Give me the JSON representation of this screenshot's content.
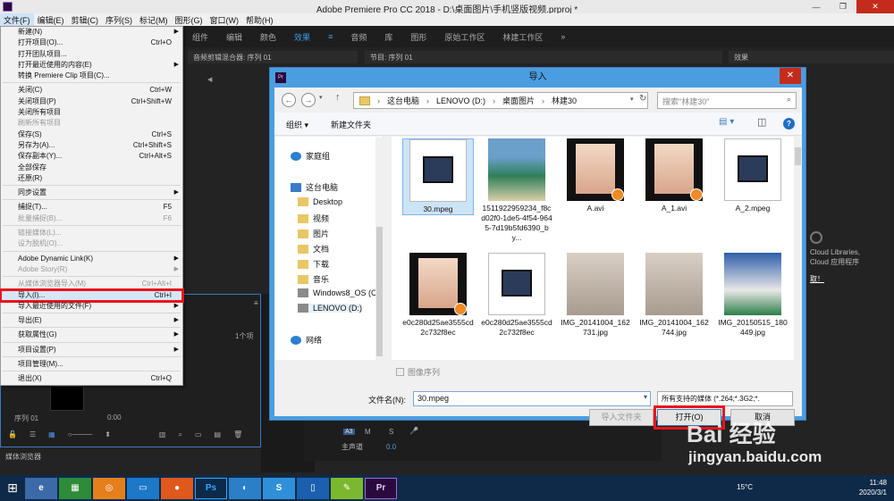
{
  "window": {
    "title": "Adobe Premiere Pro CC 2018 - D:\\桌面图片\\手机竖版视频.prproj *"
  },
  "menubar": [
    "文件(F)",
    "编辑(E)",
    "剪辑(C)",
    "序列(S)",
    "标记(M)",
    "图形(G)",
    "窗口(W)",
    "帮助(H)"
  ],
  "workspaces": [
    "组件",
    "编辑",
    "颜色",
    "效果",
    "≡",
    "音频",
    "库",
    "图形",
    "原始工作区",
    "林建工作区",
    "»"
  ],
  "panels": {
    "audio_mixer": "音频剪辑混合器: 序列 01",
    "program": "节目: 序列 01",
    "effects": "效果",
    "items_count": "1个项",
    "seq": "序列 01",
    "timecode": "0:00",
    "media_browser": "媒体浏览器",
    "track_a3": "A3",
    "master": "主声道",
    "master_val": "0.0",
    "cloud_text1": "Cloud Libraries,",
    "cloud_text2": "Cloud 应用程序",
    "cloud_text3": "取！"
  },
  "file_menu": [
    {
      "label": "新建(N)",
      "arrow": true
    },
    {
      "label": "打开项目(O)...",
      "shortcut": "Ctrl+O"
    },
    {
      "label": "打开团队项目..."
    },
    {
      "label": "打开最近使用的内容(E)",
      "arrow": true
    },
    {
      "label": "转换 Premiere Clip 项目(C)..."
    },
    {
      "sep": true
    },
    {
      "label": "关闭(C)",
      "shortcut": "Ctrl+W"
    },
    {
      "label": "关闭项目(P)",
      "shortcut": "Ctrl+Shift+W"
    },
    {
      "label": "关闭所有项目"
    },
    {
      "label": "刷新所有项目",
      "disabled": true
    },
    {
      "label": "保存(S)",
      "shortcut": "Ctrl+S"
    },
    {
      "label": "另存为(A)...",
      "shortcut": "Ctrl+Shift+S"
    },
    {
      "label": "保存副本(Y)...",
      "shortcut": "Ctrl+Alt+S"
    },
    {
      "label": "全部保存"
    },
    {
      "label": "还原(R)"
    },
    {
      "sep": true
    },
    {
      "label": "同步设置",
      "arrow": true
    },
    {
      "sep": true
    },
    {
      "label": "捕捉(T)...",
      "shortcut": "F5"
    },
    {
      "label": "批量捕捉(B)...",
      "shortcut": "F6",
      "disabled": true
    },
    {
      "sep": true
    },
    {
      "label": "链接媒体(L)...",
      "disabled": true
    },
    {
      "label": "设为脱机(O)...",
      "disabled": true
    },
    {
      "sep": true
    },
    {
      "label": "Adobe Dynamic Link(K)",
      "arrow": true
    },
    {
      "label": "Adobe Story(R)",
      "arrow": true,
      "disabled": true
    },
    {
      "sep": true
    },
    {
      "label": "从媒体浏览器导入(M)",
      "shortcut": "Ctrl+Alt+I",
      "disabled": true
    },
    {
      "label": "导入(I)...",
      "shortcut": "Ctrl+I",
      "highlight": true
    },
    {
      "label": "导入最近使用的文件(F)",
      "arrow": true
    },
    {
      "sep": true
    },
    {
      "label": "导出(E)",
      "arrow": true
    },
    {
      "sep": true
    },
    {
      "label": "获取属性(G)",
      "arrow": true
    },
    {
      "sep": true
    },
    {
      "label": "项目设置(P)",
      "arrow": true
    },
    {
      "sep": true
    },
    {
      "label": "项目管理(M)..."
    },
    {
      "sep": true
    },
    {
      "label": "退出(X)",
      "shortcut": "Ctrl+Q"
    }
  ],
  "dialog": {
    "title": "导入",
    "icon": "Pr",
    "breadcrumb": [
      "这台电脑",
      "LENOVO (D:)",
      "桌面图片",
      "林建30"
    ],
    "search_placeholder": "搜索\"林建30\"",
    "toolbar": {
      "organize": "组织 ▾",
      "new_folder": "新建文件夹"
    },
    "tree": [
      {
        "label": "家庭组",
        "icon": "homegroup-icon"
      },
      {
        "label": "这台电脑",
        "icon": "computer-icon"
      },
      {
        "label": "Desktop",
        "icon": "folder-icon"
      },
      {
        "label": "视频",
        "icon": "folder-icon"
      },
      {
        "label": "图片",
        "icon": "folder-icon"
      },
      {
        "label": "文档",
        "icon": "folder-icon"
      },
      {
        "label": "下载",
        "icon": "folder-icon"
      },
      {
        "label": "音乐",
        "icon": "folder-icon"
      },
      {
        "label": "Windows8_OS (C",
        "icon": "drive-icon"
      },
      {
        "label": "LENOVO (D:)",
        "icon": "drive-icon"
      },
      {
        "label": "网络",
        "icon": "network-icon"
      }
    ],
    "files": [
      {
        "name": "30.mpeg",
        "kind": "doc",
        "selected": true
      },
      {
        "name": "1511922959234_f8cd02f0-1de5-4f54-9645-7d19b5fd6390_by...",
        "kind": "photo"
      },
      {
        "name": "A.avi",
        "kind": "video"
      },
      {
        "name": "A_1.avi",
        "kind": "video"
      },
      {
        "name": "A_2.mpeg",
        "kind": "doc"
      },
      {
        "name": "e0c280d25ae3555cd2c732f8ec",
        "kind": "video"
      },
      {
        "name": "e0c280d25ae3555cd2c732f8ec",
        "kind": "doc"
      },
      {
        "name": "IMG_20141004_162731.jpg",
        "kind": "photo"
      },
      {
        "name": "IMG_20141004_162744.jpg",
        "kind": "photo"
      },
      {
        "name": "IMG_20150515_180449.jpg",
        "kind": "photo"
      }
    ],
    "image_sequence": "图像序列",
    "filename_label": "文件名(N):",
    "filename_value": "30.mpeg",
    "filter": "所有支持的媒体 (*.264;*.3G2;*.",
    "import_folder": "导入文件夹",
    "open": "打开(O)",
    "cancel": "取消"
  },
  "taskbar": {
    "weather": "15°C",
    "time": "11:48",
    "date": "2020/3/1"
  },
  "watermark": {
    "brand": "Bai 经验",
    "url": "jingyan.baidu.com"
  }
}
